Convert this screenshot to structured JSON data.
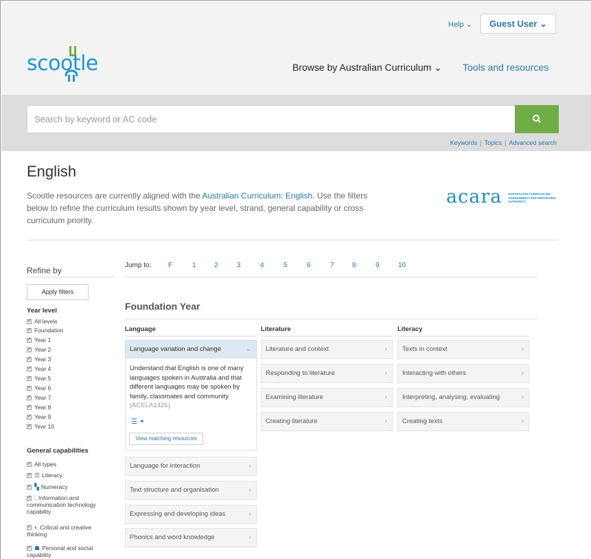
{
  "header": {
    "help_label": "Help ⌄",
    "guest_label": "Guest User ⌄",
    "logo_text": "scootle",
    "nav_browse": "Browse by Australian Curriculum ⌄",
    "nav_tools": "Tools and resources"
  },
  "search": {
    "placeholder": "Search by keyword or AC code",
    "button_icon": "search-icon",
    "links": [
      "Keywords",
      "Topics",
      "Advanced search"
    ]
  },
  "intro": {
    "title": "English",
    "text_before": "Scootle resources are currently aligned with the ",
    "link_text": "Australian Curriculum: English",
    "text_after": ". Use the filters below to refine the curriculum results shown by year level, strand, general capability or cross curriculum priority.",
    "acara_word": "acara",
    "acara_sub": "AUSTRALIAN CURRICULUM, ASSESSMENT AND REPORTING AUTHORITY"
  },
  "sidebar": {
    "title": "Refine by",
    "apply_label": "Apply filters",
    "year_level_title": "Year level",
    "year_levels": [
      "All levels",
      "Foundation",
      "Year 1",
      "Year 2",
      "Year 3",
      "Year 4",
      "Year 5",
      "Year 6",
      "Year 7",
      "Year 8",
      "Year 9",
      "Year 10"
    ],
    "gc_title": "General capabilities",
    "gc_items": [
      {
        "label": "All types",
        "icon": ""
      },
      {
        "label": "Literacy",
        "icon": "literacy-icon"
      },
      {
        "label": "Numeracy",
        "icon": "numeracy-icon"
      },
      {
        "label": "Information and communication technology capability",
        "icon": "ict-icon"
      },
      {
        "label": "Critical and creative thinking",
        "icon": "critical-thinking-icon"
      },
      {
        "label": "Personal and social capability",
        "icon": "personal-social-icon"
      }
    ]
  },
  "main": {
    "jump_label": "Jump to:",
    "jump_items": [
      "F",
      "1",
      "2",
      "3",
      "4",
      "5",
      "6",
      "7",
      "8",
      "9",
      "10"
    ],
    "year_title": "Foundation Year",
    "columns": {
      "language": {
        "title": "Language",
        "active_tile": "Language variation and change",
        "description": "Understand that English is one of many languages spoken in Australia and that different languages may be spoken by family, classmates and community",
        "code": "(ACELA1426)",
        "view_label": "View matching resources",
        "other_tiles": [
          "Language for interaction",
          "Text structure and organisation",
          "Expressing and developing ideas",
          "Phonics and word knowledge"
        ]
      },
      "literature": {
        "title": "Literature",
        "tiles": [
          "Literature and context",
          "Responding to literature",
          "Examining literature",
          "Creating literature"
        ]
      },
      "literacy": {
        "title": "Literacy",
        "tiles": [
          "Texts in context",
          "Interacting with others",
          "Interpreting, analysing, evaluating",
          "Creating texts"
        ]
      }
    }
  },
  "colors": {
    "accent_blue": "#2a78a8",
    "logo_blue": "#1f97cb",
    "search_green": "#71ad47",
    "active_tile": "#dde8f3"
  }
}
